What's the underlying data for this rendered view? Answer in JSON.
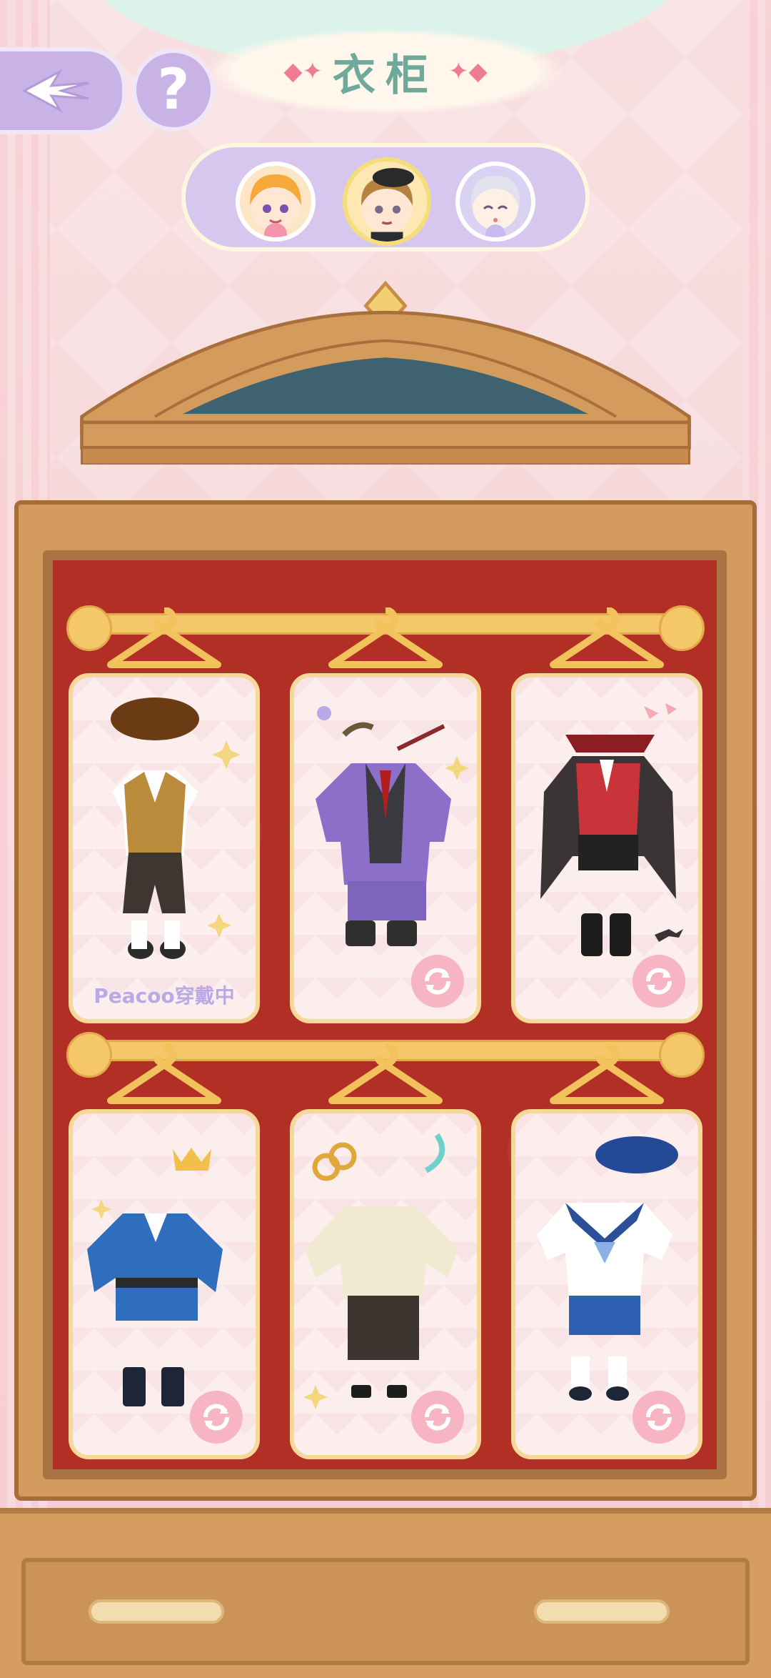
{
  "header": {
    "title": "衣柜",
    "back_icon": "back-arrow-icon",
    "help_label": "?"
  },
  "characters": [
    {
      "name": "orange-hair-girl",
      "selected": false
    },
    {
      "name": "brown-hair-boy-beret",
      "selected": true
    },
    {
      "name": "silver-hair-child",
      "selected": false
    }
  ],
  "outfits": [
    {
      "id": "school-vest-outfit",
      "wearing": true,
      "wearing_label": "Peacoo穿戴中"
    },
    {
      "id": "purple-suit-outfit",
      "wearing": false
    },
    {
      "id": "vampire-outfit",
      "wearing": false
    },
    {
      "id": "blue-prince-outfit",
      "wearing": false
    },
    {
      "id": "cream-chinese-outfit",
      "wearing": false
    },
    {
      "id": "sailor-outfit",
      "wearing": false
    }
  ],
  "colors": {
    "accent_lavender": "#c9b3e6",
    "title_green": "#6fa99a",
    "wardrobe_wood": "#d29a5c",
    "wardrobe_red": "#b22f26",
    "swap_pink": "#f7b4c3"
  }
}
